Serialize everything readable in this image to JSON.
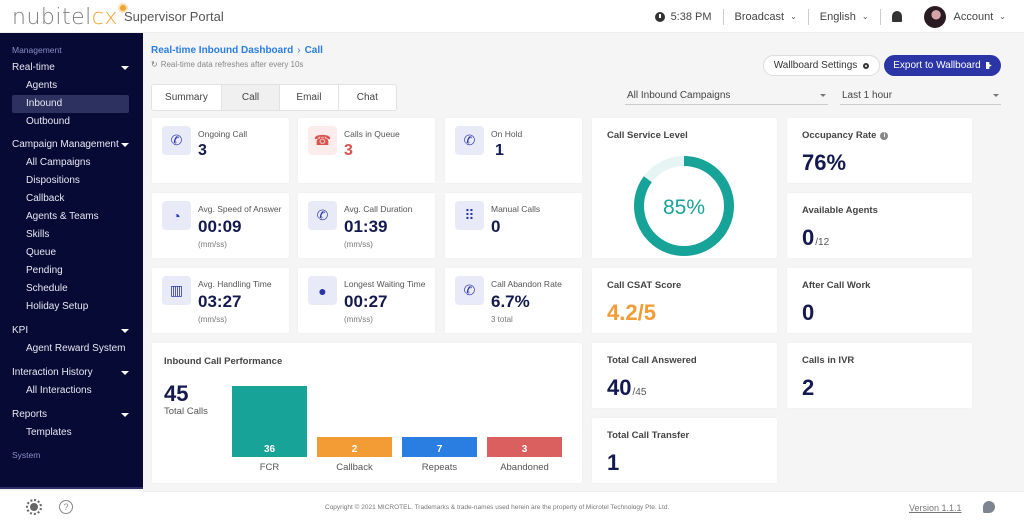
{
  "app": {
    "logo_gray": "nubitel",
    "logo_orange": "cx",
    "title": "Supervisor Portal"
  },
  "topbar": {
    "time": "5:38 PM",
    "broadcast": "Broadcast",
    "language": "English",
    "account": "Account"
  },
  "sidebar": {
    "sections": [
      {
        "title": "Management"
      },
      {
        "title": "System"
      }
    ],
    "groups": [
      {
        "label": "Real-time",
        "items": [
          "Agents",
          "Inbound",
          "Outbound"
        ],
        "active": "Inbound"
      },
      {
        "label": "Campaign Management",
        "items": [
          "All Campaigns",
          "Dispositions",
          "Callback",
          "Agents & Teams",
          "Skills",
          "Queue",
          "Pending",
          "Schedule",
          "Holiday Setup"
        ]
      },
      {
        "label": "KPI",
        "items": [
          "Agent Reward System"
        ]
      },
      {
        "label": "Interaction History",
        "items": [
          "All Interactions"
        ]
      },
      {
        "label": "Reports",
        "items": [
          "Templates"
        ]
      }
    ]
  },
  "header": {
    "breadcrumb_root": "Real-time Inbound Dashboard",
    "breadcrumb_sep": "›",
    "breadcrumb_current": "Call",
    "refresh_icon": "↻",
    "refresh_text": "Real-time data refreshes after every 10s",
    "wallboard_settings": "Wallboard Settings",
    "export_wallboard": "Export to Wallboard"
  },
  "tabs": [
    {
      "label": "Summary",
      "active": false
    },
    {
      "label": "Call",
      "active": true
    },
    {
      "label": "Email",
      "active": false
    },
    {
      "label": "Chat",
      "active": false
    }
  ],
  "filters": {
    "campaign": "All Inbound Campaigns",
    "period": "Last 1 hour"
  },
  "mini_cards": [
    {
      "label": "Ongoing Call",
      "value": "3",
      "icon": "phone-ringing-icon"
    },
    {
      "label": "Calls in Queue",
      "value": "3",
      "icon": "phone-hangup-alert-icon",
      "color": "#d9534f"
    },
    {
      "label": "On Hold",
      "value": "1",
      "icon": "phone-ringing-icon"
    },
    {
      "label": "Avg. Speed of Answer",
      "value": "00:09",
      "sub": "(mm/ss)",
      "icon": "timer-icon"
    },
    {
      "label": "Avg. Call Duration",
      "value": "01:39",
      "sub": "(mm/ss)",
      "icon": "phone-clock-icon"
    },
    {
      "label": "Manual Calls",
      "value": "0",
      "icon": "dialpad-icon"
    },
    {
      "label": "Avg. Handling Time",
      "value": "03:27",
      "sub": "(mm/ss)",
      "icon": "bars-phone-icon"
    },
    {
      "label": "Longest Waiting Time",
      "value": "00:27",
      "sub": "(mm/ss)",
      "icon": "user-clock-icon"
    },
    {
      "label": "Call Abandon Rate",
      "value": "6.7%",
      "sub": "3 total",
      "icon": "phone-missed-icon"
    }
  ],
  "service_level": {
    "label": "Call Service Level",
    "value": "85%",
    "fraction": 0.85,
    "color": "#17a398"
  },
  "kpi_cards": [
    {
      "label": "Occupancy Rate",
      "value": "76%",
      "info": "i"
    },
    {
      "label": "Available Agents",
      "value": "0",
      "denominator": "/12"
    },
    {
      "label": "Call CSAT Score",
      "value": "4.2/5",
      "color": "#f39b34"
    },
    {
      "label": "After Call Work",
      "value": "0"
    },
    {
      "label": "Total Call Answered",
      "value": "40",
      "denominator": "/45"
    },
    {
      "label": "Calls in IVR",
      "value": "2"
    },
    {
      "label": "Total Call Transfer",
      "value": "1"
    }
  ],
  "performance": {
    "title": "Inbound Call Performance",
    "total": "45",
    "total_label": "Total Calls"
  },
  "chart_data": {
    "type": "bar",
    "title": "Inbound Call Performance",
    "categories": [
      "FCR",
      "Callback",
      "Repeats",
      "Abandoned"
    ],
    "values": [
      36,
      2,
      7,
      3
    ],
    "colors": [
      "#17a398",
      "#f39b34",
      "#2a7de1",
      "#d9605f"
    ],
    "xlabel": "",
    "ylabel": "",
    "grid": false
  },
  "footer": {
    "copyright": "Copyright © 2021 MICROTEL. Trademarks & trade-names used herein are the property of Microtel Technology Pte. Ltd.",
    "version": "Version 1.1.1"
  }
}
